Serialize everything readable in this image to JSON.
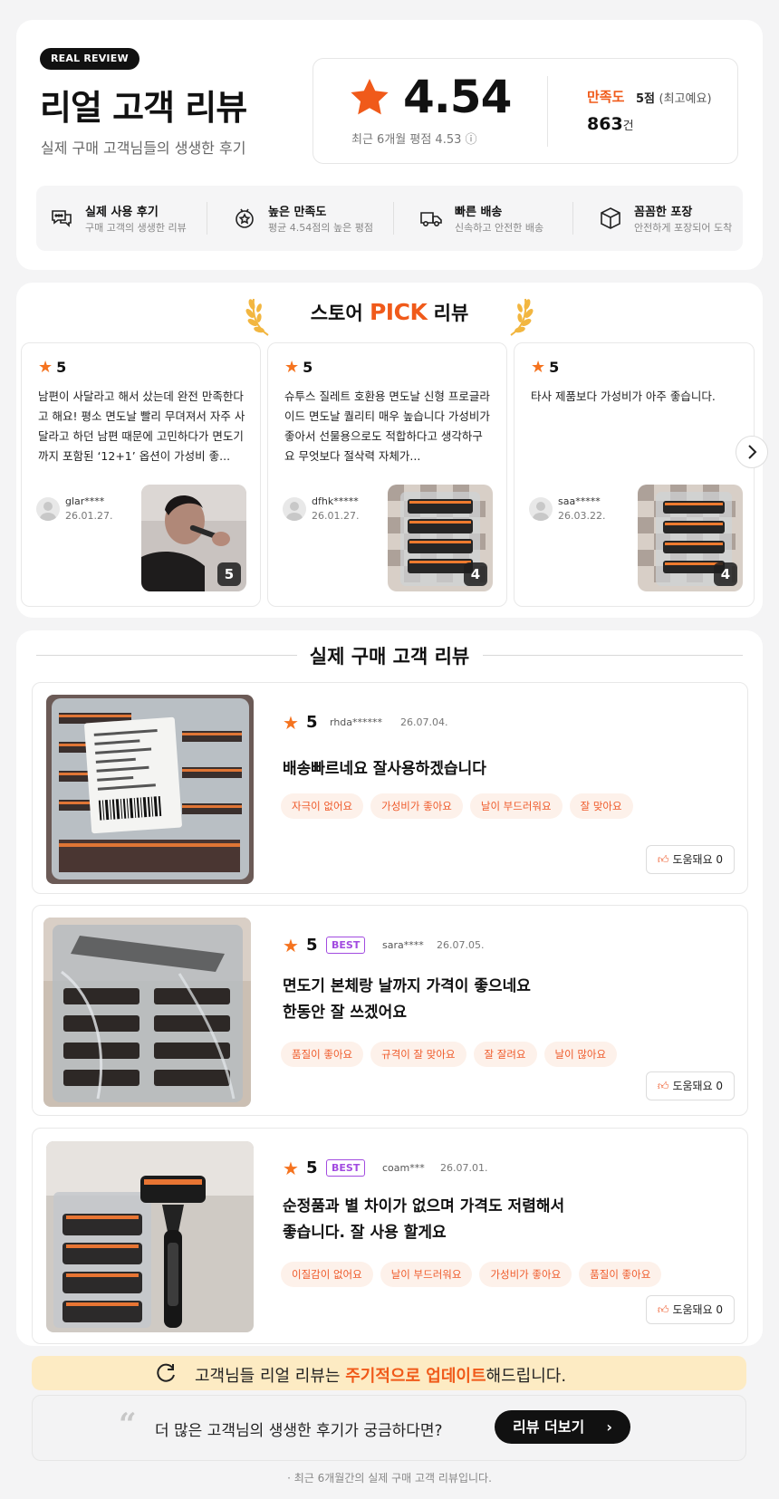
{
  "hero": {
    "badge": "REAL REVIEW",
    "title": "리얼 고객 리뷰",
    "subtitle": "실제 구매 고객님들의 생생한 후기",
    "score": "4.54",
    "recent_avg": "최근 6개월 평점 4.53 ⓘ",
    "satisfaction_label": "만족도",
    "satisfaction_value": "5점",
    "satisfaction_note": "(최고예요)",
    "count_number": "863",
    "count_unit": "건"
  },
  "features": [
    {
      "title": "실제 사용 후기",
      "desc": "구매 고객의 생생한 리뷰",
      "icon": "chat-icon"
    },
    {
      "title": "높은 만족도",
      "desc": "평균 4.54점의 높은 평점",
      "icon": "medal-icon"
    },
    {
      "title": "빠른 배송",
      "desc": "신속하고 안전한 배송",
      "icon": "truck-icon"
    },
    {
      "title": "꼼꼼한 포장",
      "desc": "안전하게 포장되어 도착",
      "icon": "box-icon"
    }
  ],
  "pick": {
    "title_pre": "스토어 ",
    "title_highlight": "PICK",
    "title_post": " 리뷰",
    "cards": [
      {
        "rating": "5",
        "text": "남편이 사달라고 해서 샀는데 완전 만족한다고 해요! 평소 면도날 빨리 무뎌져서 자주 사달라고 하던 남편 때문에 고민하다가 면도기까지 포함된 ‘12+1’ 옵션이 가성비 좋...",
        "user": "glar****",
        "date": "26.01.27.",
        "photo_count": "5"
      },
      {
        "rating": "5",
        "text": "슈투스 질레트 호환용 면도날 신형 프로글라이드 면도날 퀄리티 매우 높습니다 가성비가 좋아서 선물용으로도 적합하다고 생각하구요 무엇보다 절삭력 자체가...",
        "user": "dfhk*****",
        "date": "26.01.27.",
        "photo_count": "4"
      },
      {
        "rating": "5",
        "text": "타사 제품보다 가성비가 아주 좋습니다.",
        "user": "saa*****",
        "date": "26.03.22.",
        "photo_count": "4"
      }
    ]
  },
  "reviews_section": {
    "title": "실제 구매 고객 리뷰",
    "items": [
      {
        "rating": "5",
        "best": "",
        "user": "rhda******",
        "date": "26.07.04.",
        "text": "배송빠르네요 잘사용하겠습니다",
        "tags": [
          "자극이 없어요",
          "가성비가 좋아요",
          "날이 부드러워요",
          "잘 맞아요"
        ],
        "helpful": "도움돼요 0"
      },
      {
        "rating": "5",
        "best": "BEST",
        "user": "sara****",
        "date": "26.07.05.",
        "text": "면도기 본체랑 날까지 가격이 좋으네요\n한동안 잘 쓰겠어요",
        "tags": [
          "품질이 좋아요",
          "규격이 잘 맞아요",
          "잘 잘려요",
          "날이 많아요"
        ],
        "helpful": "도움돼요 0"
      },
      {
        "rating": "5",
        "best": "BEST",
        "user": "coam***",
        "date": "26.07.01.",
        "text": "순정품과 별 차이가 없으며 가격도 저렴해서\n좋습니다. 잘 사용 할게요",
        "tags": [
          "이질감이 없어요",
          "날이 부드러워요",
          "가성비가 좋아요",
          "품질이 좋아요"
        ],
        "helpful": "도움돼요 0"
      }
    ]
  },
  "update_banner": {
    "pre": "고객님들 리얼 리뷰는 ",
    "highlight": "주기적으로 업데이트",
    "post": "해드립니다."
  },
  "more": {
    "question": "더 많은 고객님의 생생한 후기가 궁금하다면?",
    "button": "리뷰 더보기"
  },
  "footnote": "· 최근 6개월간의 실제 구매 고객 리뷰입니다.",
  "colors": {
    "accent": "#f05a1a",
    "star": "#f5731f",
    "best": "#a24be0",
    "tag_bg": "#fdf1ea",
    "banner": "#fdebc3"
  }
}
